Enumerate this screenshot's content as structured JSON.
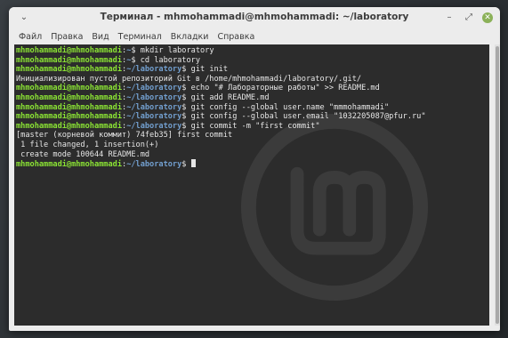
{
  "window": {
    "title": "Терминал - mhmohammadi@mhmohammadi: ~/laboratory",
    "menu_icon": "chevron-down-icon",
    "controls": {
      "minimize": "–",
      "maximize": "⤢",
      "close": "✕"
    }
  },
  "menubar": {
    "items": [
      "Файл",
      "Правка",
      "Вид",
      "Терминал",
      "Вкладки",
      "Справка"
    ]
  },
  "terminal": {
    "prompt_user": "mhmohammadi@mhmohammadi",
    "lines": [
      {
        "type": "prompt",
        "path": "~",
        "command": " mkdir laboratory"
      },
      {
        "type": "prompt",
        "path": "~",
        "command": " cd laboratory"
      },
      {
        "type": "prompt",
        "path": "~/laboratory",
        "command": " git init"
      },
      {
        "type": "output",
        "text": "Инициализирован пустой репозиторий Git в /home/mhmohammadi/laboratory/.git/"
      },
      {
        "type": "prompt",
        "path": "~/laboratory",
        "command": " echo \"# Лабораторные работы\" >> README.md"
      },
      {
        "type": "prompt",
        "path": "~/laboratory",
        "command": " git add README.md"
      },
      {
        "type": "prompt",
        "path": "~/laboratory",
        "command": " git config --global user.name \"mmmohammadi\""
      },
      {
        "type": "prompt",
        "path": "~/laboratory",
        "command": " git config --global user.email \"1032205087@pfur.ru\""
      },
      {
        "type": "prompt",
        "path": "~/laboratory",
        "command": " git commit -m \"first commit\""
      },
      {
        "type": "output",
        "text": "[master (корневой коммит) 74feb35] first commit"
      },
      {
        "type": "output",
        "text": " 1 file changed, 1 insertion(+)"
      },
      {
        "type": "output",
        "text": " create mode 100644 README.md"
      },
      {
        "type": "prompt",
        "path": "~/laboratory",
        "command": " ",
        "cursor": true
      }
    ]
  },
  "colors": {
    "user": "#8ae234",
    "path": "#729fcf",
    "background": "#2c2c2c",
    "text": "#e6e6e6"
  }
}
